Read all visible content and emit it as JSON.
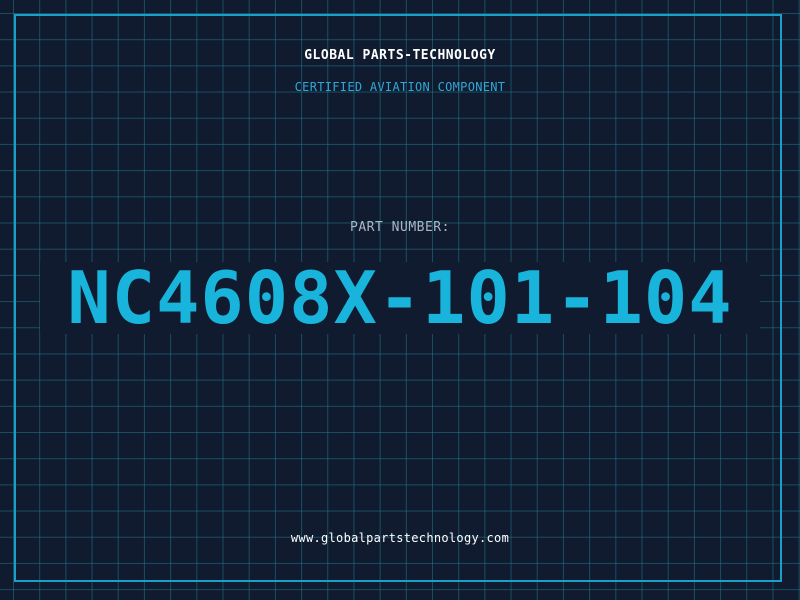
{
  "company_name": "GLOBAL PARTS-TECHNOLOGY",
  "tagline": "CERTIFIED AVIATION COMPONENT",
  "part_label": "PART NUMBER:",
  "part_number": "NC4608X-101-104",
  "website": "www.globalpartstechnology.com",
  "colors": {
    "background": "#111b2f",
    "grid": "#20788c",
    "frame": "#1a9fc9",
    "accent": "#19b4dc",
    "label": "#aab7c8",
    "text": "#ffffff"
  }
}
